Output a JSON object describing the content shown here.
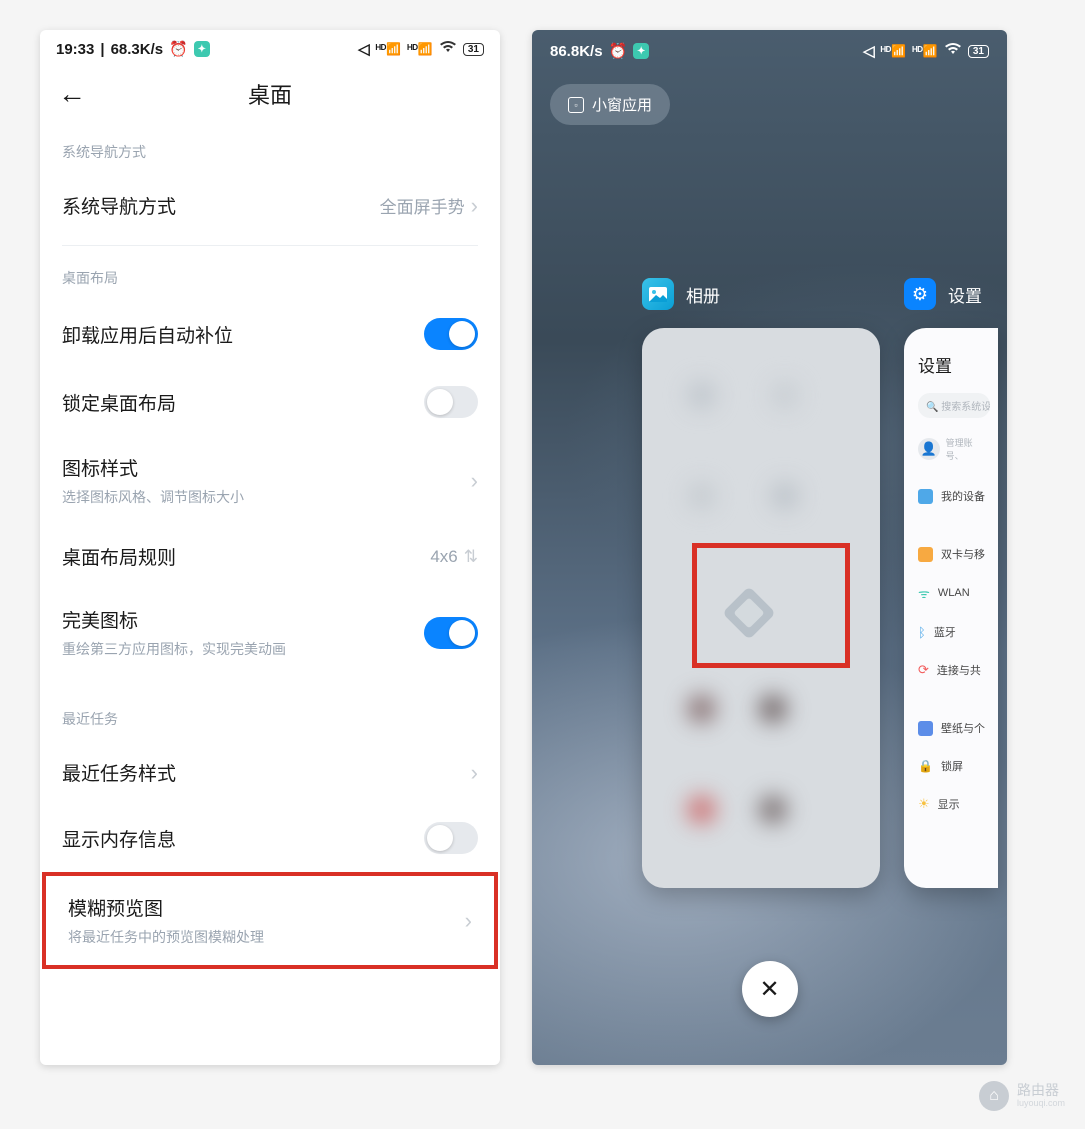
{
  "left": {
    "status": {
      "time": "19:33",
      "speed": "68.3K/s",
      "battery": "31"
    },
    "header_title": "桌面",
    "sections": {
      "nav_label": "系统导航方式",
      "nav_item": {
        "title": "系统导航方式",
        "value": "全面屏手势"
      },
      "layout_label": "桌面布局",
      "auto_fill": {
        "title": "卸载应用后自动补位",
        "on": true
      },
      "lock_layout": {
        "title": "锁定桌面布局",
        "on": false
      },
      "icon_style": {
        "title": "图标样式",
        "sub": "选择图标风格、调节图标大小"
      },
      "grid": {
        "title": "桌面布局规则",
        "value": "4x6"
      },
      "perfect_icon": {
        "title": "完美图标",
        "sub": "重绘第三方应用图标，实现完美动画",
        "on": true
      },
      "recent_label": "最近任务",
      "recent_style": {
        "title": "最近任务样式"
      },
      "show_memory": {
        "title": "显示内存信息",
        "on": false
      },
      "blur_preview": {
        "title": "模糊预览图",
        "sub": "将最近任务中的预览图模糊处理"
      }
    }
  },
  "right": {
    "status": {
      "speed": "86.8K/s",
      "battery": "31"
    },
    "chip_label": "小窗应用",
    "apps": {
      "gallery": "相册",
      "settings": "设置"
    },
    "settings_card": {
      "title": "设置",
      "search_placeholder": "搜索系统设",
      "account_sub": "管理账号、",
      "items": {
        "device": "我的设备",
        "sim": "双卡与移",
        "wlan": "WLAN",
        "bt": "蓝牙",
        "conn": "连接与共",
        "wallpaper": "壁纸与个",
        "lock": "锁屏",
        "display": "显示"
      }
    }
  },
  "watermark": {
    "name": "路由器",
    "sub": "luyouqi.com"
  }
}
